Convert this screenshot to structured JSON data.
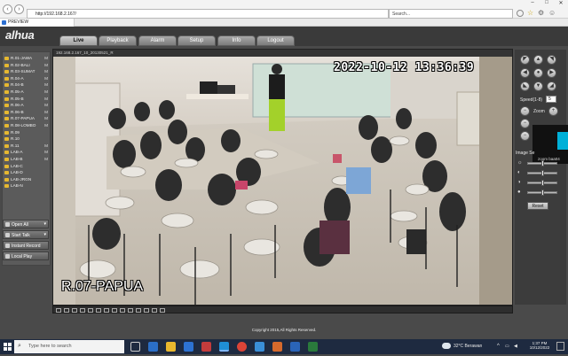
{
  "browser": {
    "url": "http://192.168.2.167/",
    "search_placeholder": "Search...",
    "tab_title": "PREVIEW"
  },
  "app": {
    "logo": "alhua",
    "tabs": [
      {
        "label": "Live",
        "active": true
      },
      {
        "label": "Playback",
        "active": false
      },
      {
        "label": "Alarm",
        "active": false
      },
      {
        "label": "Setup",
        "active": false
      },
      {
        "label": "Info",
        "active": false
      },
      {
        "label": "Logout",
        "active": false
      }
    ]
  },
  "channels": [
    {
      "label": "R.01-JAWA",
      "m": "M"
    },
    {
      "label": "R.02-BALI",
      "m": "M"
    },
    {
      "label": "R.03-SUMAT",
      "m": "M"
    },
    {
      "label": "R.04-A",
      "m": "M"
    },
    {
      "label": "R.04-B",
      "m": "M"
    },
    {
      "label": "R.05-A",
      "m": "M"
    },
    {
      "label": "R.05-B",
      "m": "M"
    },
    {
      "label": "R.06-A",
      "m": "M"
    },
    {
      "label": "R.06-B",
      "m": "M"
    },
    {
      "label": "R.07-PAPUA",
      "m": "M"
    },
    {
      "label": "R.08-LOMBO",
      "m": "M"
    },
    {
      "label": "R.09",
      "m": ""
    },
    {
      "label": "R.10",
      "m": ""
    },
    {
      "label": "R.11",
      "m": "M"
    },
    {
      "label": "LAB-A",
      "m": "M"
    },
    {
      "label": "LAB-B",
      "m": "M"
    },
    {
      "label": "LAB-C",
      "m": ""
    },
    {
      "label": "LAB-D",
      "m": ""
    },
    {
      "label": "LAB-JRGN",
      "m": ""
    },
    {
      "label": "LAB-N",
      "m": ""
    }
  ],
  "side_buttons": {
    "open_all": "Open All",
    "start_talk": "Start Talk",
    "instant_record": "Instant Record",
    "local_play": "Local Play"
  },
  "video": {
    "title_bar": "192.168.2.167_10_20130521_R",
    "timestamp": "2022-10-12 13:36:39",
    "camera_label": "R.07-PAPUA"
  },
  "ptz": {
    "speed_label": "Speed(1-8)",
    "speed_value": "5",
    "zoom_label": "Zoom",
    "image_settings_label": "Image Se",
    "tooltip_text": "zoom baa04",
    "reset_label": "Reset"
  },
  "footer": {
    "copyright": "Copyright 2015,All Rights Reserved."
  },
  "taskbar": {
    "search_placeholder": "Type here to search",
    "weather": "32°C  Berawan",
    "time": "1:37 PM",
    "date": "10/12/2022"
  }
}
